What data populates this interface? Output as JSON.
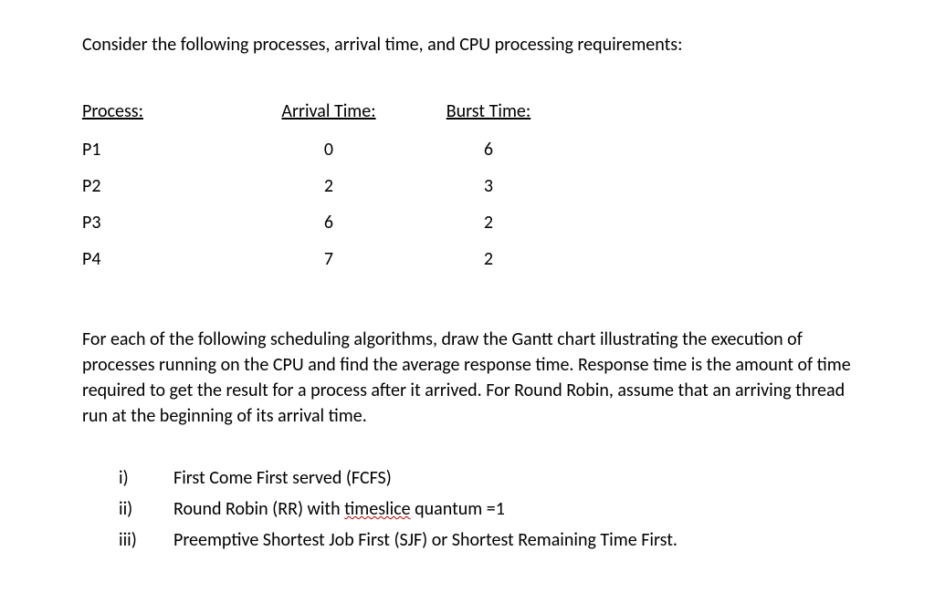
{
  "intro": "Consider the following processes, arrival time, and CPU processing requirements:",
  "headers": {
    "process": "Process:",
    "arrival": "Arrival Time:",
    "burst": "Burst Time:"
  },
  "rows": [
    {
      "process": "P1",
      "arrival": "0",
      "burst": "6"
    },
    {
      "process": "P2",
      "arrival": "2",
      "burst": "3"
    },
    {
      "process": "P3",
      "arrival": "6",
      "burst": "2"
    },
    {
      "process": "P4",
      "arrival": "7",
      "burst": "2"
    }
  ],
  "description": "For each of the following scheduling algorithms, draw the Gantt chart illustrating the execution of processes running on the CPU and find the average response time. Response time is the amount of time required to get the result for a process after it arrived. For Round Robin, assume that an arriving thread run at the beginning of its arrival time.",
  "list": [
    {
      "marker": "i)",
      "text": "First Come First served (FCFS)"
    },
    {
      "marker": "ii)",
      "pre": "Round Robin (RR) with ",
      "spell": "timeslice",
      "post": " quantum =1"
    },
    {
      "marker": "iii)",
      "text": "Preemptive Shortest Job First (SJF) or Shortest Remaining Time First."
    }
  ]
}
